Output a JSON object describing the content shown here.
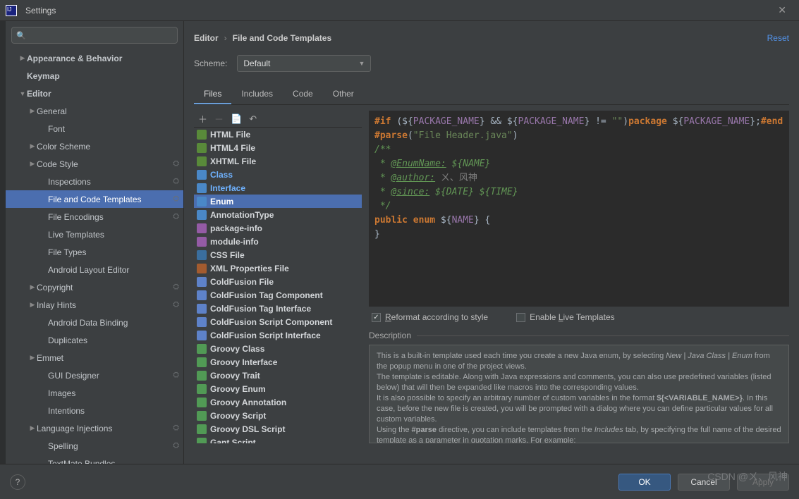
{
  "window": {
    "title": "Settings",
    "close": "✕"
  },
  "search": {
    "placeholder": ""
  },
  "nav": [
    {
      "lbl": "Appearance & Behavior",
      "d": 1,
      "bold": 1,
      "arr": "▶"
    },
    {
      "lbl": "Keymap",
      "d": 1,
      "bold": 1
    },
    {
      "lbl": "Editor",
      "d": 1,
      "bold": 1,
      "arr": "▼"
    },
    {
      "lbl": "General",
      "d": 2,
      "arr": "▶"
    },
    {
      "lbl": "Font",
      "d": 3
    },
    {
      "lbl": "Color Scheme",
      "d": 2,
      "arr": "▶"
    },
    {
      "lbl": "Code Style",
      "d": 2,
      "arr": "▶",
      "gear": 1
    },
    {
      "lbl": "Inspections",
      "d": 3,
      "gear": 1
    },
    {
      "lbl": "File and Code Templates",
      "d": 3,
      "gear": 1,
      "hl": 1
    },
    {
      "lbl": "File Encodings",
      "d": 3,
      "gear": 1
    },
    {
      "lbl": "Live Templates",
      "d": 3
    },
    {
      "lbl": "File Types",
      "d": 3
    },
    {
      "lbl": "Android Layout Editor",
      "d": 3
    },
    {
      "lbl": "Copyright",
      "d": 2,
      "arr": "▶",
      "gear": 1
    },
    {
      "lbl": "Inlay Hints",
      "d": 2,
      "arr": "▶",
      "gear": 1
    },
    {
      "lbl": "Android Data Binding",
      "d": 3
    },
    {
      "lbl": "Duplicates",
      "d": 3
    },
    {
      "lbl": "Emmet",
      "d": 2,
      "arr": "▶"
    },
    {
      "lbl": "GUI Designer",
      "d": 3,
      "gear": 1
    },
    {
      "lbl": "Images",
      "d": 3
    },
    {
      "lbl": "Intentions",
      "d": 3
    },
    {
      "lbl": "Language Injections",
      "d": 2,
      "arr": "▶",
      "gear": 1
    },
    {
      "lbl": "Spelling",
      "d": 3,
      "gear": 1
    },
    {
      "lbl": "TextMate Bundles",
      "d": 3
    }
  ],
  "breadcrumb": {
    "a": "Editor",
    "sep": "›",
    "b": "File and Code Templates",
    "reset": "Reset"
  },
  "scheme": {
    "label": "Scheme:",
    "value": "Default"
  },
  "tabs": [
    "Files",
    "Includes",
    "Code",
    "Other"
  ],
  "active_tab": 0,
  "toolbar": {
    "add": "＋",
    "remove": "－",
    "copy": "📄",
    "undo": "↶"
  },
  "templates": [
    {
      "name": "HTML File",
      "ico": "ico-html"
    },
    {
      "name": "HTML4 File",
      "ico": "ico-html"
    },
    {
      "name": "XHTML File",
      "ico": "ico-html"
    },
    {
      "name": "Class",
      "ico": "ico-class",
      "blue": 1
    },
    {
      "name": "Interface",
      "ico": "ico-iface",
      "blue": 1
    },
    {
      "name": "Enum",
      "ico": "ico-enum",
      "blue": 1,
      "sel": 1
    },
    {
      "name": "AnnotationType",
      "ico": "ico-anno"
    },
    {
      "name": "package-info",
      "ico": "ico-info"
    },
    {
      "name": "module-info",
      "ico": "ico-info"
    },
    {
      "name": "CSS File",
      "ico": "ico-css"
    },
    {
      "name": "XML Properties File",
      "ico": "ico-xml"
    },
    {
      "name": "ColdFusion File",
      "ico": "ico-cf"
    },
    {
      "name": "ColdFusion Tag Component",
      "ico": "ico-cf"
    },
    {
      "name": "ColdFusion Tag Interface",
      "ico": "ico-cf"
    },
    {
      "name": "ColdFusion Script Component",
      "ico": "ico-cf"
    },
    {
      "name": "ColdFusion Script Interface",
      "ico": "ico-cf"
    },
    {
      "name": "Groovy Class",
      "ico": "ico-groovy"
    },
    {
      "name": "Groovy Interface",
      "ico": "ico-groovy"
    },
    {
      "name": "Groovy Trait",
      "ico": "ico-groovy"
    },
    {
      "name": "Groovy Enum",
      "ico": "ico-groovy"
    },
    {
      "name": "Groovy Annotation",
      "ico": "ico-groovy"
    },
    {
      "name": "Groovy Script",
      "ico": "ico-groovy"
    },
    {
      "name": "Groovy DSL Script",
      "ico": "ico-groovy"
    },
    {
      "name": "Gant Script",
      "ico": "ico-groovy"
    }
  ],
  "code": {
    "l1_a": "#if ",
    "l1_b": "(",
    "l1_c": "${",
    "l1_d": "PACKAGE_NAME",
    "l1_e": "}",
    "l1_f": " && ",
    "l1_g": "${",
    "l1_h": "PACKAGE_NAME",
    "l1_i": "}",
    "l1_j": " != ",
    "l1_k": "\"\"",
    "l1_l": ")",
    "l1_m": "package ",
    "l1_n": "${",
    "l1_o": "PACKAGE_NAME",
    "l1_p": "}",
    "l1_q": ";",
    "l1_r": "#end",
    "l2_a": "#parse",
    "l2_b": "(",
    "l2_c": "\"File Header.java\"",
    "l2_d": ")",
    "l3": "/**",
    "l4_a": " * ",
    "l4_b": "@EnumName:",
    "l4_c": " ${",
    "l4_d": "NAME",
    "l4_e": "}",
    "l5_a": " * ",
    "l5_b": "@author:",
    "l5_c": " ㄨ、风神",
    "l6_a": " * ",
    "l6_b": "@since:",
    "l6_c": " ${",
    "l6_d": "DATE",
    "l6_e": "} ${",
    "l6_f": "TIME",
    "l6_g": "}",
    "l7": " */",
    "l8_a": "public enum ",
    "l8_b": "${",
    "l8_c": "NAME",
    "l8_d": "}",
    "l8_e": " {",
    "l9": "}"
  },
  "checks": {
    "reformat": "Reformat according to style",
    "reformat_on": true,
    "livet": "Enable Live Templates",
    "livet_on": false
  },
  "desc": {
    "title": "Description",
    "body": "This is a built-in template used each time you create a new Java enum, by selecting <i>New | Java Class | Enum</i> from the popup menu in one of the project views.<br>The template is editable. Along with Java expressions and comments, you can also use predefined variables (listed below) that will then be expanded like macros into the corresponding values.<br>It is also possible to specify an arbitrary number of custom variables in the format <b>${&lt;VARIABLE_NAME&gt;}</b>. In this case, before the new file is created, you will be prompted with a dialog where you can define particular values for all custom variables.<br>Using the <b>#parse</b> directive, you can include templates from the <i>Includes</i> tab, by specifying the full name of the desired template as a parameter in quotation marks. For example:<br><b>#parse(\"File Header.java\")</b>"
  },
  "footer": {
    "help": "?",
    "ok": "OK",
    "cancel": "Cancel",
    "apply": "Apply"
  },
  "watermark": "CSDN @ㄨ、风神"
}
